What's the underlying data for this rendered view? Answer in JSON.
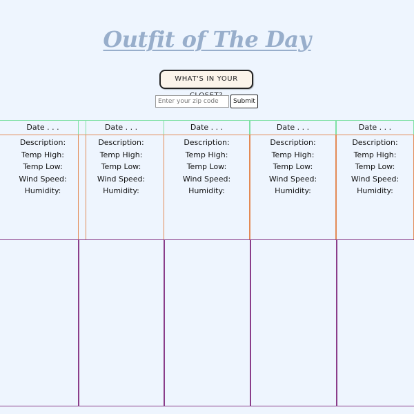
{
  "header": {
    "title": "Outfit of The Day",
    "closet_button_label": "WHAT'S IN YOUR CLOSET?"
  },
  "search": {
    "placeholder": "Enter your zip code",
    "value": "",
    "submit_label": "Submit"
  },
  "forecast": {
    "cards": [
      {
        "date": "Date . . .",
        "description": "Description:",
        "temp_high": "Temp High:",
        "temp_low": "Temp Low:",
        "wind_speed": "Wind Speed:",
        "humidity": "Humidity:"
      },
      {
        "date": "Date . . .",
        "description": "Description:",
        "temp_high": "Temp High:",
        "temp_low": "Temp Low:",
        "wind_speed": "Wind Speed:",
        "humidity": "Humidity:"
      },
      {
        "date": "Date . . .",
        "description": "Description:",
        "temp_high": "Temp High:",
        "temp_low": "Temp Low:",
        "wind_speed": "Wind Speed:",
        "humidity": "Humidity:"
      },
      {
        "date": "Date . . .",
        "description": "Description:",
        "temp_high": "Temp High:",
        "temp_low": "Temp Low:",
        "wind_speed": "Wind Speed:",
        "humidity": "Humidity:"
      },
      {
        "date": "Date . . .",
        "description": "Description:",
        "temp_high": "Temp High:",
        "temp_low": "Temp Low:",
        "wind_speed": "Wind Speed:",
        "humidity": "Humidity:"
      }
    ]
  },
  "colors": {
    "background": "#eef5fe",
    "title": "#98aecb",
    "date_border": "#7fe0a5",
    "info_border": "#e38a55",
    "outfit_border": "#8a3d8a"
  }
}
